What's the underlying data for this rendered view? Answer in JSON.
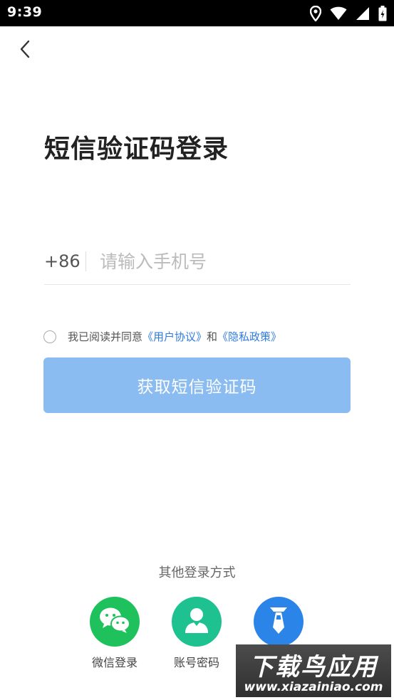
{
  "status_bar": {
    "time": "9:39",
    "icons": [
      "location-icon",
      "wifi-icon",
      "signal-icon",
      "battery-icon"
    ]
  },
  "header": {
    "back_icon": "chevron-left-icon"
  },
  "page": {
    "title": "短信验证码登录"
  },
  "phone": {
    "country_code": "+86",
    "placeholder": "请输入手机号",
    "value": ""
  },
  "agreement": {
    "prefix": "我已阅读并同意",
    "user_agreement": "《用户协议》",
    "conjunction": "和",
    "privacy_policy": "《隐私政策》"
  },
  "primary_button": {
    "label": "获取短信验证码"
  },
  "other_login": {
    "title": "其他登录方式",
    "options": [
      {
        "label": "微信登录",
        "icon": "wechat-icon",
        "color": "#1fc15c"
      },
      {
        "label": "账号密码",
        "icon": "person-icon",
        "color": "#1ec190"
      },
      {
        "label": "",
        "icon": "necktie-icon",
        "color": "#2b84e8"
      }
    ]
  },
  "watermark": {
    "title": "下载鸟应用",
    "url": "www.xiazainiao.com"
  }
}
